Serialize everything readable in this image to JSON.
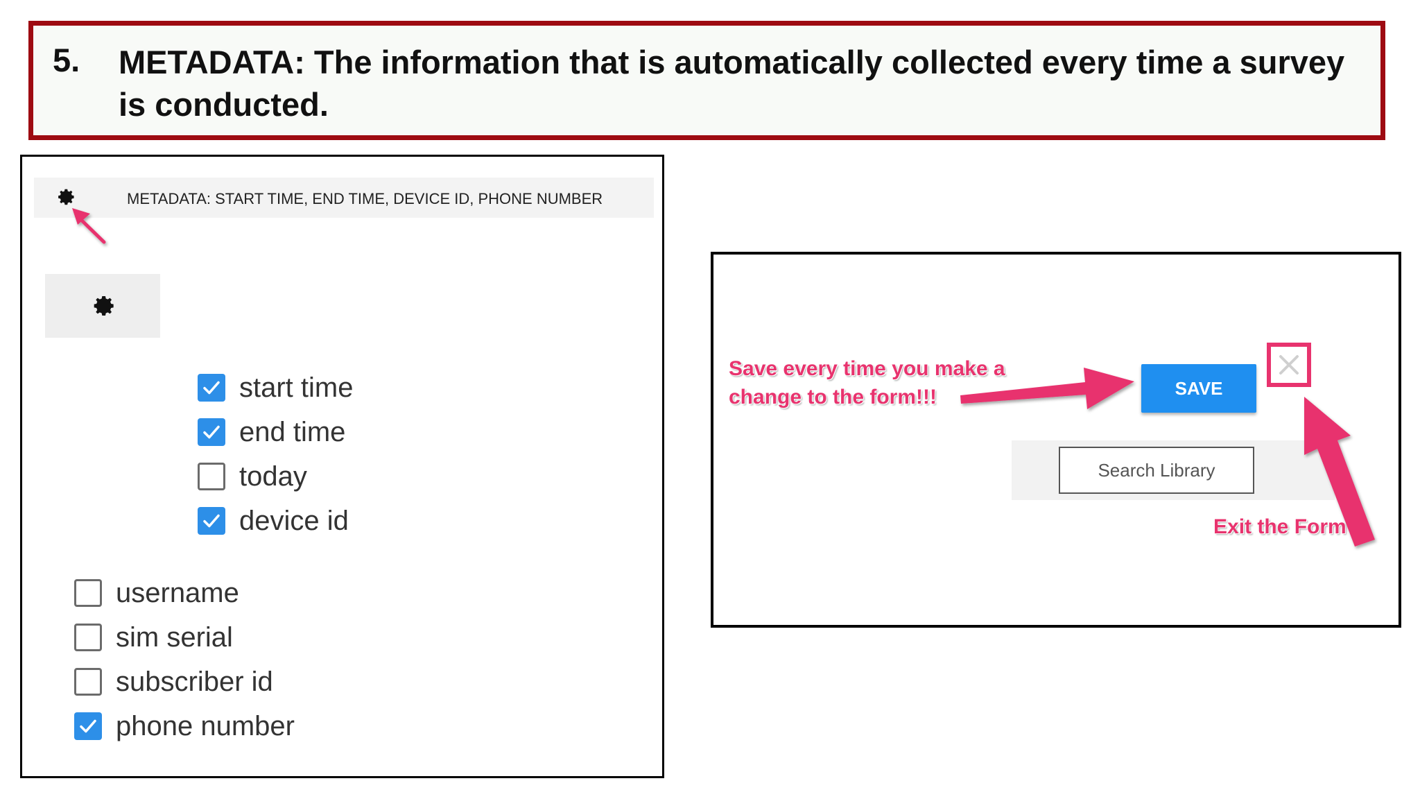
{
  "banner": {
    "number": "5.",
    "text": "METADATA: The information that is automatically collected every time a survey is conducted."
  },
  "metadata_bar": {
    "text": "METADATA:   START TIME, END TIME, DEVICE ID, PHONE NUMBER"
  },
  "checkboxes": [
    {
      "label": "start time",
      "checked": true
    },
    {
      "label": "end time",
      "checked": true
    },
    {
      "label": "today",
      "checked": false
    },
    {
      "label": "device id",
      "checked": true
    },
    {
      "label": "username",
      "checked": false
    },
    {
      "label": "sim serial",
      "checked": false
    },
    {
      "label": "subscriber id",
      "checked": false
    },
    {
      "label": "phone number",
      "checked": true
    }
  ],
  "toolbar": {
    "save_label": "SAVE",
    "search_label": "Search Library"
  },
  "annotations": {
    "save_note": "Save every time you make a change to the form!!!",
    "exit_note": "Exit the Form"
  },
  "colors": {
    "banner_border": "#9e0b12",
    "accent_blue": "#1f8ff0",
    "annotation_pink": "#e8336e"
  },
  "icons": [
    "gear-icon",
    "checkmark-icon",
    "close-icon",
    "arrow-icon"
  ]
}
